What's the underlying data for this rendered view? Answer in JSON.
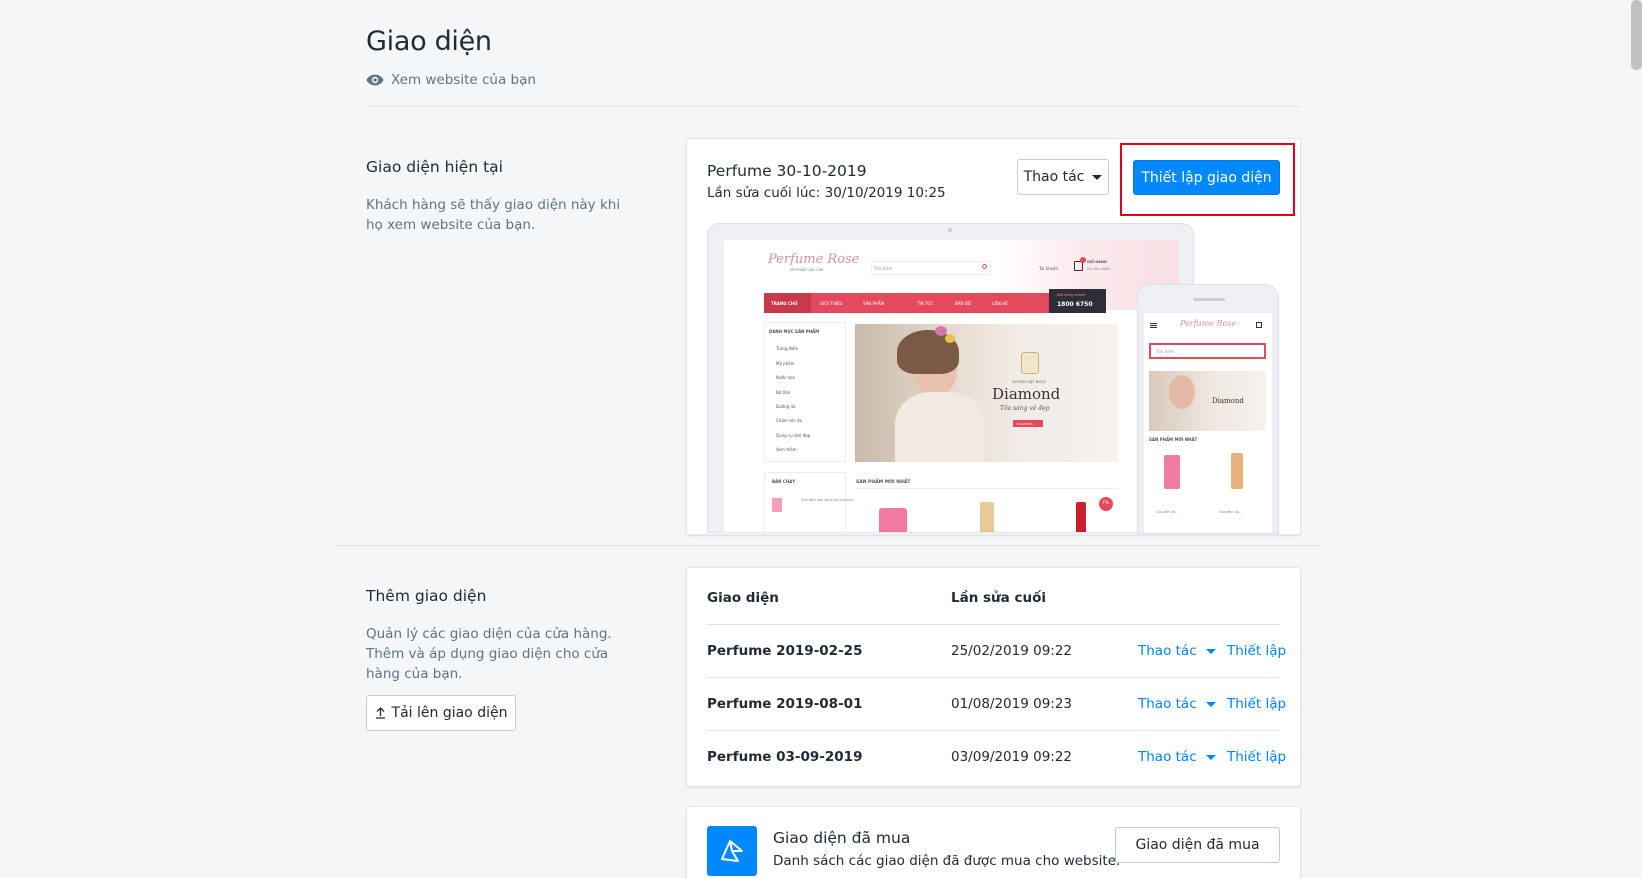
{
  "header": {
    "title": "Giao diện",
    "view_link": "Xem website của bạn"
  },
  "current_theme": {
    "section_title": "Giao diện hiện tại",
    "section_desc": "Khách hàng sẽ thấy giao diện này khi họ xem website của bạn.",
    "theme_name": "Perfume 30-10-2019",
    "last_edited": "Lần sửa cuối lúc: 30/10/2019 10:25",
    "actions_label": "Thao tác",
    "customize_label": "Thiết lập giao diện"
  },
  "preview": {
    "logo": "Perfume Rose",
    "logo_sub": "MỸ PHẨM CAO CẤP",
    "search_placeholder": "Tìm kiếm",
    "account": "Tài khoản",
    "cart": "GIỎ HÀNG",
    "cart_sub": "(0) sản phẩm",
    "nav": [
      "TRANG CHỦ",
      "GIỚI THIỆU",
      "SẢN PHẨM",
      "TIN TỨC",
      "BẢN ĐỒ",
      "LIÊN HỆ"
    ],
    "hotline_label": "Đặt hàng nhanh",
    "hotline": "1800 6750",
    "category_title": "DANH MỤC SẢN PHẨM",
    "categories": [
      "Trang điểm",
      "Mỹ phẩm",
      "Nước hoa",
      "Bộ tắm",
      "Dưỡng da",
      "Chăm sóc da",
      "Dụng cụ làm đẹp",
      "Xem thêm"
    ],
    "banner_small": "DƯƠNG HẬT NGỌC",
    "banner_title": "Diamond",
    "banner_script": "Tỏa sáng vẻ đẹp",
    "banner_button": "KHÁM PHÁ",
    "bestseller": "BÁN CHẠY",
    "bestseller_item": "Sữa tắm làm sáng da Victoria",
    "new_products": "SẢN PHẨM MỚI NHẤT",
    "discount_badge": "7%",
    "mobile_item_1": "Sữa tắm tẩ...",
    "mobile_item_2": "Sữa tắm Sp..."
  },
  "add_theme": {
    "section_title": "Thêm giao diện",
    "section_desc": "Quản lý các giao diện của cửa hàng. Thêm và áp dụng giao diện cho cửa hàng của bạn.",
    "upload_label": "Tải lên giao diện"
  },
  "themes_table": {
    "col_theme": "Giao diện",
    "col_edited": "Lần sửa cuối",
    "rows": [
      {
        "name": "Perfume 2019-02-25",
        "edited": "25/02/2019 09:22",
        "action": "Thao tác",
        "setup": "Thiết lập"
      },
      {
        "name": "Perfume 2019-08-01",
        "edited": "01/08/2019 09:23",
        "action": "Thao tác",
        "setup": "Thiết lập"
      },
      {
        "name": "Perfume 03-09-2019",
        "edited": "03/09/2019 09:22",
        "action": "Thao tác",
        "setup": "Thiết lập"
      }
    ]
  },
  "purchased": {
    "title": "Giao diện đã mua",
    "desc": "Danh sách các giao diện đã được mua cho website.",
    "button": "Giao diện đã mua"
  },
  "colors": {
    "primary": "#0088ff",
    "link": "#0084ff",
    "highlight": "#e2001a",
    "preview_nav": "#e5495c"
  }
}
